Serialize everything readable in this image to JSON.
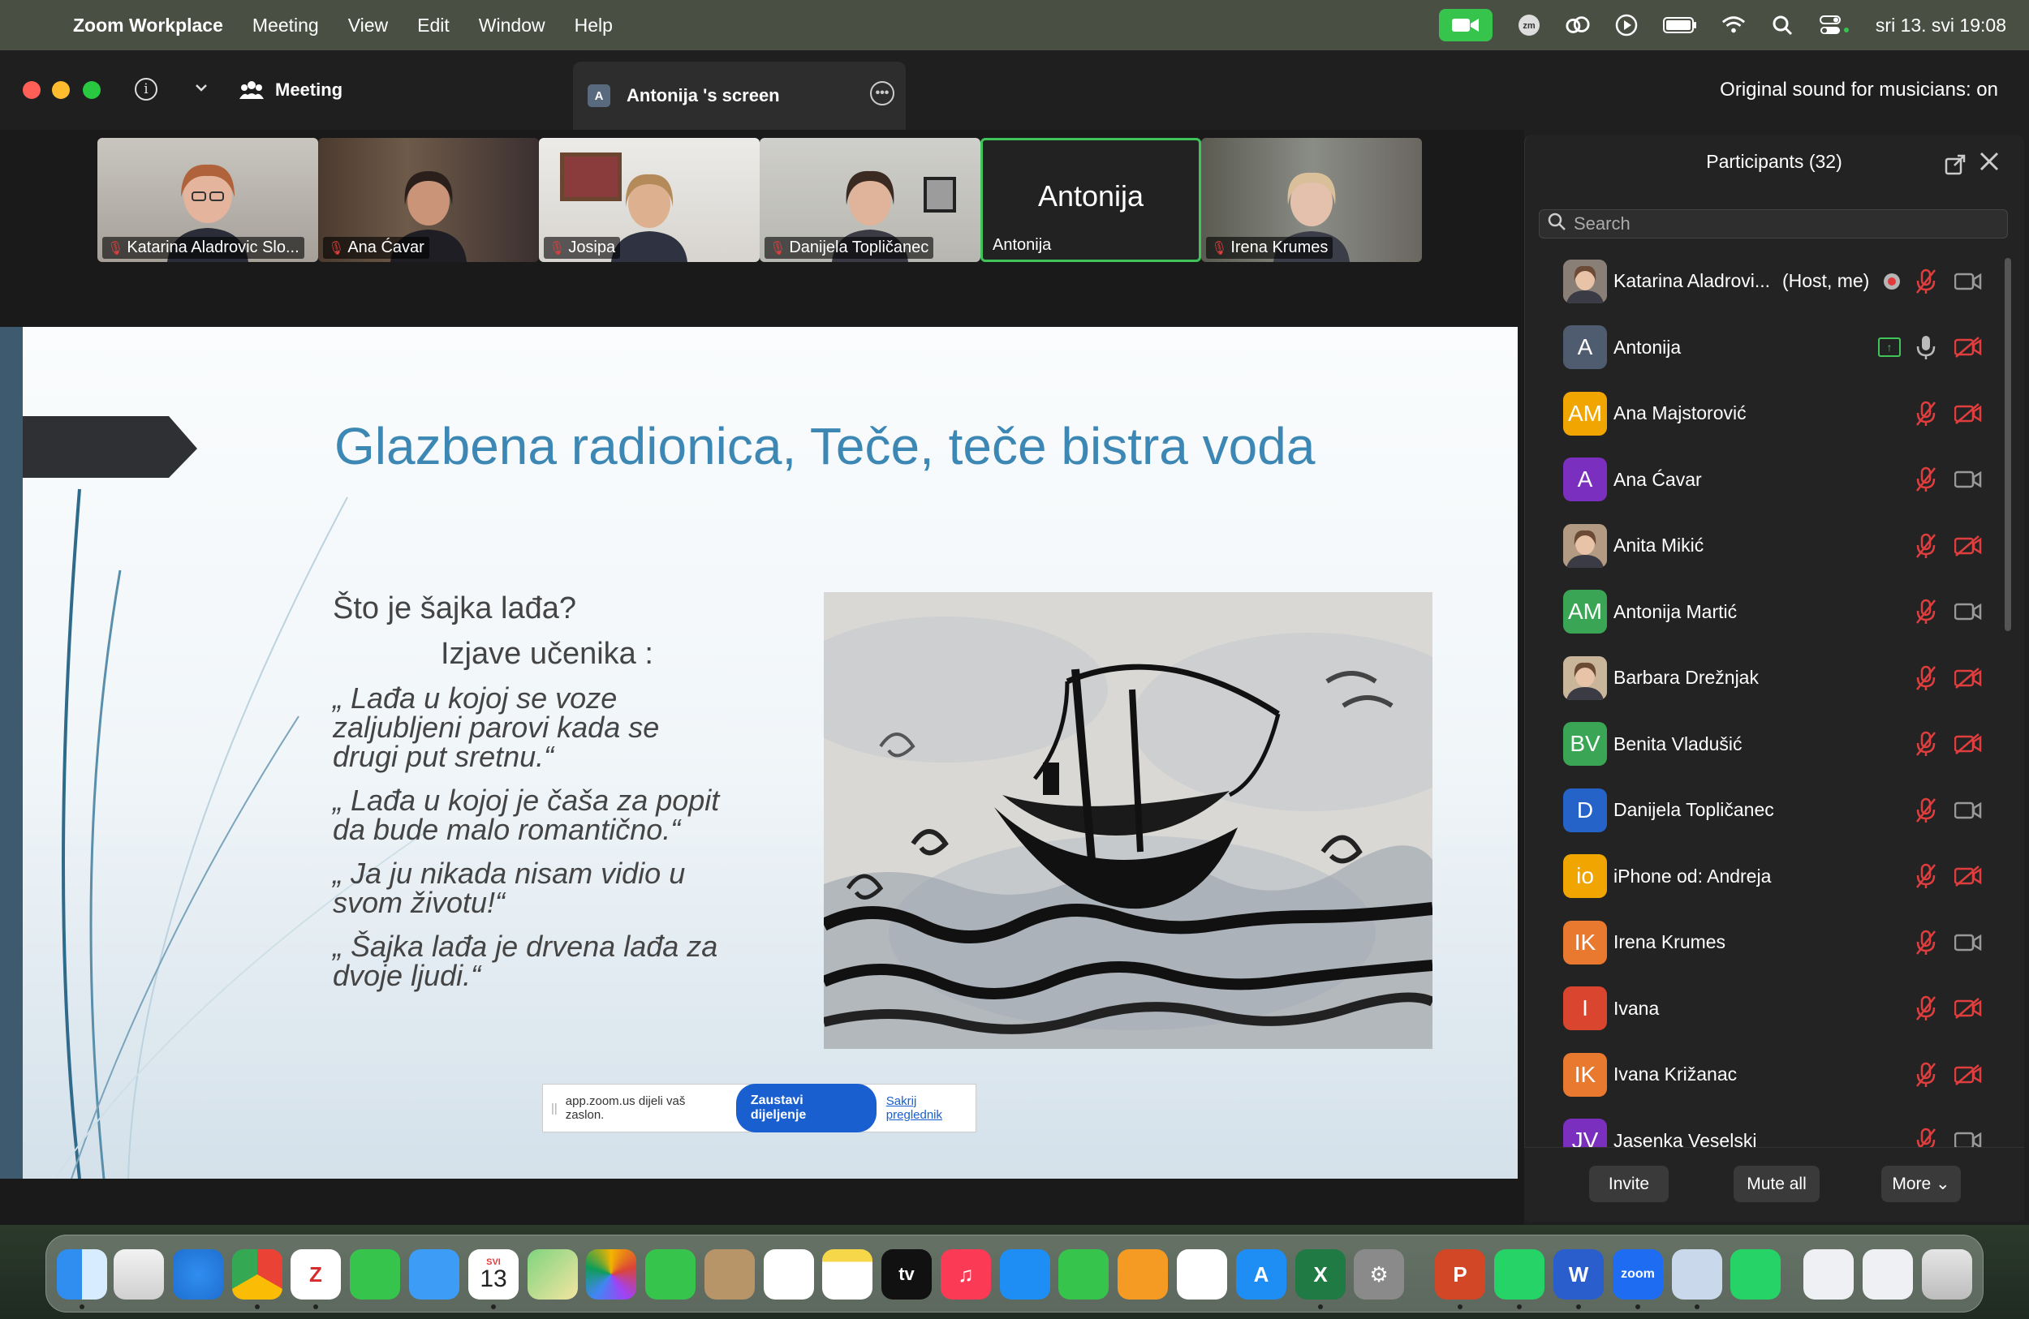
{
  "menubar": {
    "app_name": "Zoom Workplace",
    "items": [
      "Meeting",
      "View",
      "Edit",
      "Window",
      "Help"
    ],
    "clock": "sri 13. svi  19:08",
    "tray_zm": "zm"
  },
  "titlebar": {
    "meeting_tab": "Meeting",
    "screen_tab_badge": "A",
    "screen_tab": "Antonija 's screen",
    "sound_status": "Original sound for musicians: on"
  },
  "thumbnails": [
    {
      "name": "Katarina Aladrovic Slo...",
      "muted": true
    },
    {
      "name": "Ana Ćavar",
      "muted": true
    },
    {
      "name": "Josipa",
      "muted": true
    },
    {
      "name": "Danijela Topličanec",
      "muted": true
    },
    {
      "name": "Antonija",
      "center_label": "Antonija",
      "muted": false,
      "active": true
    },
    {
      "name": "Irena Krumes",
      "muted": true
    }
  ],
  "slide": {
    "title": "Glazbena radionica, Teče, teče bistra voda",
    "question": "Što je šajka lađa?",
    "subtitle": "Izjave učenika :",
    "quote1_l1": "„ Lađa u kojoj se voze",
    "quote1_l2": "zaljubljeni parovi kada se",
    "quote1_l3": "drugi put sretnu.“",
    "quote2_l1": "„ Lađa u kojoj je čaša za popit",
    "quote2_l2": "da bude malo romantično.“",
    "quote3_l1": "„ Ja ju nikada nisam vidio u",
    "quote3_l2": "svom životu!“",
    "quote4_l1": "„ Šajka lađa je drvena lađa za",
    "quote4_l2": "dvoje ljudi.“"
  },
  "share_bar": {
    "message": "app.zoom.us dijeli vaš zaslon.",
    "stop_label": "Zaustavi dijeljenje",
    "hide_label": "Sakrij preglednik"
  },
  "panel": {
    "title": "Participants (32)",
    "search_placeholder": "Search",
    "participants": [
      {
        "initials": "",
        "name": "Katarina Aladrovi...",
        "role": "(Host, me)",
        "color": "#8a7f76",
        "photo": true,
        "mic": "muted",
        "cam": "on"
      },
      {
        "initials": "A",
        "name": "Antonija",
        "role": "",
        "color": "#4f5b6e",
        "photo": false,
        "mic": "on",
        "cam": "off",
        "sharing": true
      },
      {
        "initials": "AM",
        "name": "Ana Majstorović",
        "role": "",
        "color": "#f0a500",
        "photo": false,
        "mic": "muted",
        "cam": "off"
      },
      {
        "initials": "A",
        "name": "Ana Ćavar",
        "role": "",
        "color": "#7b2fbf",
        "photo": false,
        "mic": "muted",
        "cam": "on"
      },
      {
        "initials": "",
        "name": "Anita Mikić",
        "role": "",
        "color": "#b39a82",
        "photo": true,
        "mic": "muted",
        "cam": "off"
      },
      {
        "initials": "AM",
        "name": "Antonija Martić",
        "role": "",
        "color": "#3aa655",
        "photo": false,
        "mic": "muted",
        "cam": "on"
      },
      {
        "initials": "",
        "name": "Barbara Drežnjak",
        "role": "",
        "color": "#c9b59a",
        "photo": true,
        "mic": "muted",
        "cam": "off"
      },
      {
        "initials": "BV",
        "name": "Benita Vladušić",
        "role": "",
        "color": "#3aa655",
        "photo": false,
        "mic": "muted",
        "cam": "off"
      },
      {
        "initials": "D",
        "name": "Danijela Topličanec",
        "role": "",
        "color": "#2563c9",
        "photo": false,
        "mic": "muted",
        "cam": "on"
      },
      {
        "initials": "io",
        "name": "iPhone od: Andreja",
        "role": "",
        "color": "#f0a500",
        "photo": false,
        "mic": "muted",
        "cam": "off"
      },
      {
        "initials": "IK",
        "name": "Irena Krumes",
        "role": "",
        "color": "#e8792e",
        "photo": false,
        "mic": "muted",
        "cam": "on"
      },
      {
        "initials": "I",
        "name": "Ivana",
        "role": "",
        "color": "#d9452f",
        "photo": false,
        "mic": "muted",
        "cam": "off"
      },
      {
        "initials": "IK",
        "name": "Ivana Križanac",
        "role": "",
        "color": "#e8792e",
        "photo": false,
        "mic": "muted",
        "cam": "off"
      },
      {
        "initials": "JV",
        "name": "Jasenka Veselski",
        "role": "",
        "color": "#7b2fbf",
        "photo": false,
        "mic": "muted",
        "cam": "on"
      }
    ],
    "invite_label": "Invite",
    "mute_all_label": "Mute all",
    "more_label": "More ⌄"
  },
  "dock": {
    "calendar_month": "SVI",
    "calendar_day": "13",
    "zoom_label": "zoom",
    "tv_label": "tv"
  }
}
